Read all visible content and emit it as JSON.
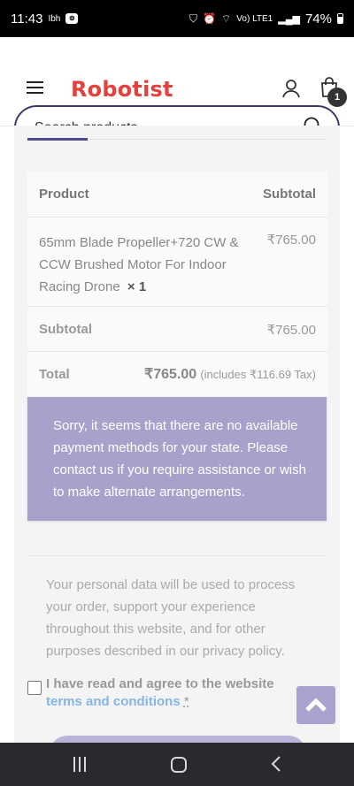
{
  "status_bar": {
    "time": "11:43",
    "carrier_tag": "Ibh",
    "network": "Vo) LTE1",
    "battery": "74%"
  },
  "header": {
    "logo": "Robotist",
    "cart_count": "1",
    "search": {
      "placeholder": "Search products..."
    }
  },
  "order_table": {
    "col_product": "Product",
    "col_subtotal": "Subtotal",
    "item": {
      "name": "65mm Blade Propeller+720 CW & CCW Brushed Motor For Indoor Racing Drone",
      "qty": "× 1",
      "price": "₹765.00"
    },
    "subtotal_label": "Subtotal",
    "subtotal_value": "₹765.00",
    "total_label": "Total",
    "total_value": "₹765.00",
    "tax_note": "(includes ₹116.69 Tax)"
  },
  "notice": "Sorry, it seems that there are no available payment methods for your state. Please contact us if you require assistance or wish to make alternate arrangements.",
  "privacy_text": "Your personal data will be used to process your order, support your experience throughout this website, and for other purposes described in our privacy policy.",
  "terms": {
    "prefix": "I have read and agree to the website ",
    "link": "terms and conditions",
    "required_mark": "*"
  },
  "colors": {
    "brand": "#e5403b",
    "accent": "#4e4a8a",
    "notice_bg": "#a7a2cc",
    "link": "#86b4e3"
  }
}
